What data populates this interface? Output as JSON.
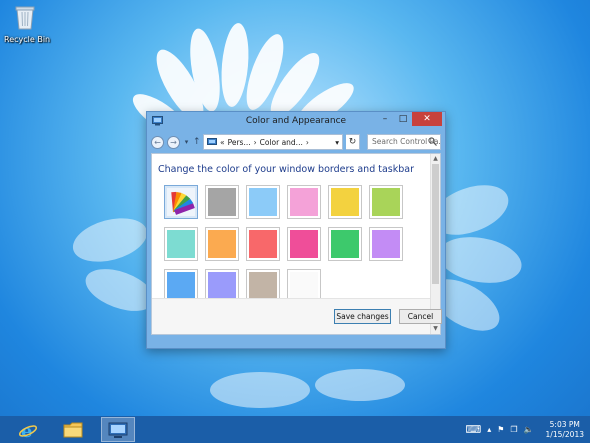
{
  "desktop": {
    "recycle_bin_label": "Recycle Bin"
  },
  "window": {
    "title": "Color and Appearance",
    "buttons": {
      "minimize": "–",
      "maximize": "□",
      "close": "✕"
    },
    "nav": {
      "back": "←",
      "forward": "→",
      "recent": "▾",
      "up": "↑",
      "address_prefix": "«",
      "crumb1": "Pers...",
      "sep1": "›",
      "crumb2": "Color and...",
      "sep2": "›",
      "address_dropdown": "▾",
      "refresh": "↻",
      "search_placeholder": "Search Control Pa..."
    },
    "heading": "Change the color of your window borders and taskbar",
    "swatches": [
      {
        "name": "automatic",
        "color": "rainbow",
        "selected": true
      },
      {
        "name": "gray",
        "color": "#a5a5a5"
      },
      {
        "name": "sky-blue",
        "color": "#8ccbf8"
      },
      {
        "name": "pink",
        "color": "#f4a2d8"
      },
      {
        "name": "yellow",
        "color": "#f3d23f"
      },
      {
        "name": "lime",
        "color": "#a9d459"
      },
      {
        "name": "teal",
        "color": "#7ddcd2"
      },
      {
        "name": "orange",
        "color": "#fbaa50"
      },
      {
        "name": "red",
        "color": "#f8686a"
      },
      {
        "name": "magenta",
        "color": "#ef4e99"
      },
      {
        "name": "green",
        "color": "#3dc96c"
      },
      {
        "name": "lavender",
        "color": "#c38cf5"
      },
      {
        "name": "blue",
        "color": "#5ba9f3"
      },
      {
        "name": "periwinkle",
        "color": "#9a9bfb"
      },
      {
        "name": "taupe",
        "color": "#c2b4a6"
      },
      {
        "name": "white",
        "color": "#fafafa"
      }
    ],
    "save_label": "Save changes",
    "cancel_label": "Cancel"
  },
  "taskbar": {
    "items": [
      "internet-explorer-icon",
      "file-explorer-icon",
      "control-panel-icon"
    ],
    "tray": {
      "keyboard": "⌨",
      "chevron": "▴",
      "flag": "⚑",
      "network": "❐",
      "volume": "🔈",
      "time": "5:03 PM",
      "date": "1/15/2013"
    }
  }
}
